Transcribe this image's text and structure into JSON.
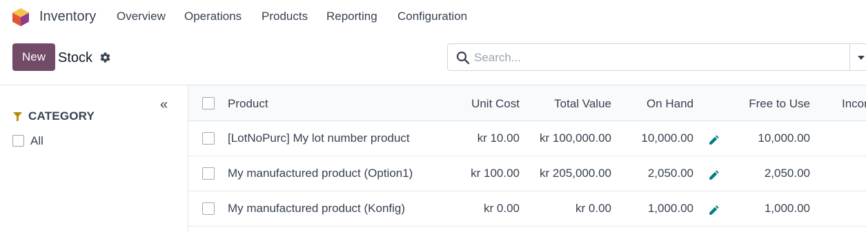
{
  "app": {
    "name": "Inventory"
  },
  "nav": [
    "Overview",
    "Operations",
    "Products",
    "Reporting",
    "Configuration"
  ],
  "control": {
    "new_label": "New",
    "title": "Stock",
    "search_placeholder": "Search..."
  },
  "sidebar": {
    "category_header": "CATEGORY",
    "items": [
      "All"
    ]
  },
  "table": {
    "columns": [
      "Product",
      "Unit Cost",
      "Total Value",
      "On Hand",
      "Free to Use",
      "Incoming"
    ],
    "rows": [
      {
        "product": "[LotNoPurc] My lot number product",
        "unit_cost": "kr 10.00",
        "total_value": "kr 100,000.00",
        "on_hand": "10,000.00",
        "free": "10,000.00"
      },
      {
        "product": "My manufactured product (Option1)",
        "unit_cost": "kr 100.00",
        "total_value": "kr 205,000.00",
        "on_hand": "2,050.00",
        "free": "2,050.00"
      },
      {
        "product": "My manufactured product (Konfig)",
        "unit_cost": "kr 0.00",
        "total_value": "kr 0.00",
        "on_hand": "1,000.00",
        "free": "1,000.00"
      }
    ]
  },
  "colors": {
    "brand": "#714B67",
    "edit_icon": "#017E84",
    "filter_icon": "#B7880B"
  },
  "icons": {
    "app": "inventory-app-icon",
    "settings": "gear-icon",
    "search": "search-icon",
    "collapse": "double-chevron-left-icon",
    "filter": "filter-icon",
    "edit": "pencil-icon"
  }
}
